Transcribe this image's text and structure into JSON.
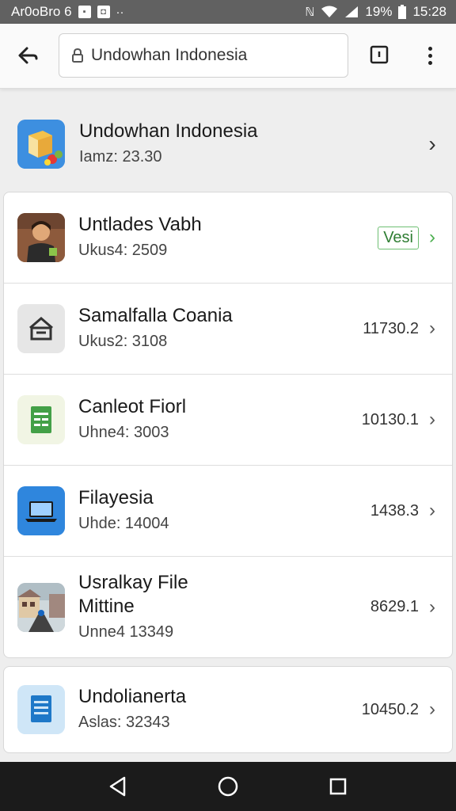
{
  "status_bar": {
    "left_text": "Ar0oBro 6",
    "battery_pct": "19%",
    "time": "15:28"
  },
  "address_bar": {
    "url": "Undowhan Indonesia"
  },
  "header": {
    "title": "Undowhan Indonesia",
    "subtitle": "Iamz: 23.30"
  },
  "items": [
    {
      "title": "Untlades Vabh",
      "subtitle": "Ukus4: 2509",
      "badge": "Vesi"
    },
    {
      "title": "Samalfalla Coania",
      "subtitle": "Ukus2: 3108",
      "value": "11730.2"
    },
    {
      "title": "Canleot Fiorl",
      "subtitle": "Uhne4: 3003",
      "value": "10130.1"
    },
    {
      "title": "Filayesia",
      "subtitle": "Uhde: 14004",
      "value": "1438.3"
    },
    {
      "title": "Usralkay File",
      "title2": "Mittine",
      "subtitle": "Unne4 13349",
      "value": "8629.1"
    }
  ],
  "last_item": {
    "title": "Undolianerta",
    "subtitle": "Aslas: 32343",
    "value": "10450.2"
  },
  "colors": {
    "status_bar": "#616161",
    "accent_blue": "#3d8fe0",
    "badge_green": "#2e7d32",
    "nav_bar": "#1b1b1b"
  }
}
